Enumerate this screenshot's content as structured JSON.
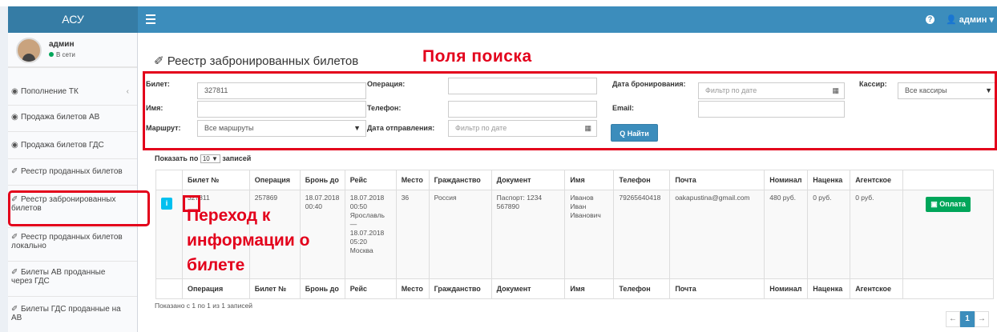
{
  "app": {
    "logo": "АСУ"
  },
  "navbar": {
    "user": "админ",
    "help_icon": "?",
    "user_icon": "👤",
    "caret": "▾"
  },
  "user_panel": {
    "name": "админ",
    "status": "В сети"
  },
  "sidebar": {
    "items": [
      {
        "label": "Пополнение ТК",
        "icon": "◉"
      },
      {
        "label": "Продажа билетов АВ",
        "icon": "◉"
      },
      {
        "label": "Продажа билетов ГДС",
        "icon": "◉"
      },
      {
        "label": "Реестр проданных билетов",
        "icon": "✐"
      },
      {
        "label": "Реестр забронированных",
        "label2": "билетов",
        "icon": "✐"
      },
      {
        "label": "Реестр проданных билетов",
        "label2": "локально",
        "icon": "✐"
      },
      {
        "label": "Билеты АВ проданные",
        "label2": "через ГДС",
        "icon": "✐"
      },
      {
        "label": "Билеты ГДС проданные на",
        "label2": "АВ",
        "icon": "✐"
      }
    ],
    "arrow": "‹"
  },
  "page": {
    "title_icon": "✐",
    "title": "Реестр забронированных билетов"
  },
  "annotations": {
    "search": "Поля поиска",
    "goto": "Переход к информации о билете"
  },
  "search": {
    "ticket_label": "Билет:",
    "ticket_value": "327811",
    "name_label": "Имя:",
    "name_value": "",
    "route_label": "Маршрут:",
    "route_value": "Все маршруты",
    "operation_label": "Операция:",
    "operation_value": "",
    "phone_label": "Телефон:",
    "phone_value": "",
    "depart_label": "Дата отправления:",
    "depart_placeholder": "Фильтр по дате",
    "booking_label": "Дата бронирования:",
    "booking_placeholder": "Фильтр по дате",
    "email_label": "Email:",
    "email_value": "",
    "cashier_label": "Кассир:",
    "cashier_value": "Все кассиры",
    "find_button": "Найти",
    "cal_icon": "▦",
    "caret": "▼"
  },
  "table_controls": {
    "show_prefix": "Показать по",
    "page_size": "10 ▼",
    "show_suffix": "записей"
  },
  "table": {
    "headers": [
      "",
      "Билет №",
      "Операция",
      "Бронь до",
      "Рейс",
      "Место",
      "Гражданство",
      "Документ",
      "Имя",
      "Телефон",
      "Почта",
      "Номинал",
      "Наценка",
      "Агентское",
      ""
    ],
    "footer_headers": [
      "",
      "Операция",
      "Билет №",
      "Бронь до",
      "Рейс",
      "Место",
      "Гражданство",
      "Документ",
      "Имя",
      "Телефон",
      "Почта",
      "Номинал",
      "Наценка",
      "Агентское",
      ""
    ],
    "row": {
      "info": "i",
      "ticket": "327811",
      "operation": "257869",
      "booked_until": "18.07.2018 00:40",
      "trip": "18.07.2018 00:50 Ярославль — 18.07.2018 05:20 Москва",
      "seat": "36",
      "citizenship": "Россия",
      "document": "Паспорт: 1234 567890",
      "name": "Иванов Иван Иванович",
      "phone": "79265640418",
      "email": "oakapustina@gmail.com",
      "nominal": "480 руб.",
      "markup": "0 руб.",
      "agent": "0 руб.",
      "pay": "Оплата"
    }
  },
  "footer": {
    "info": "Показано с 1 по 1 из 1 записей"
  },
  "pagination": {
    "prev": "←",
    "page": "1",
    "next": "→"
  },
  "colors": {
    "primary": "#3c8dbc",
    "success": "#00a65a",
    "info": "#00c0ef",
    "annotation": "#e3001b"
  }
}
